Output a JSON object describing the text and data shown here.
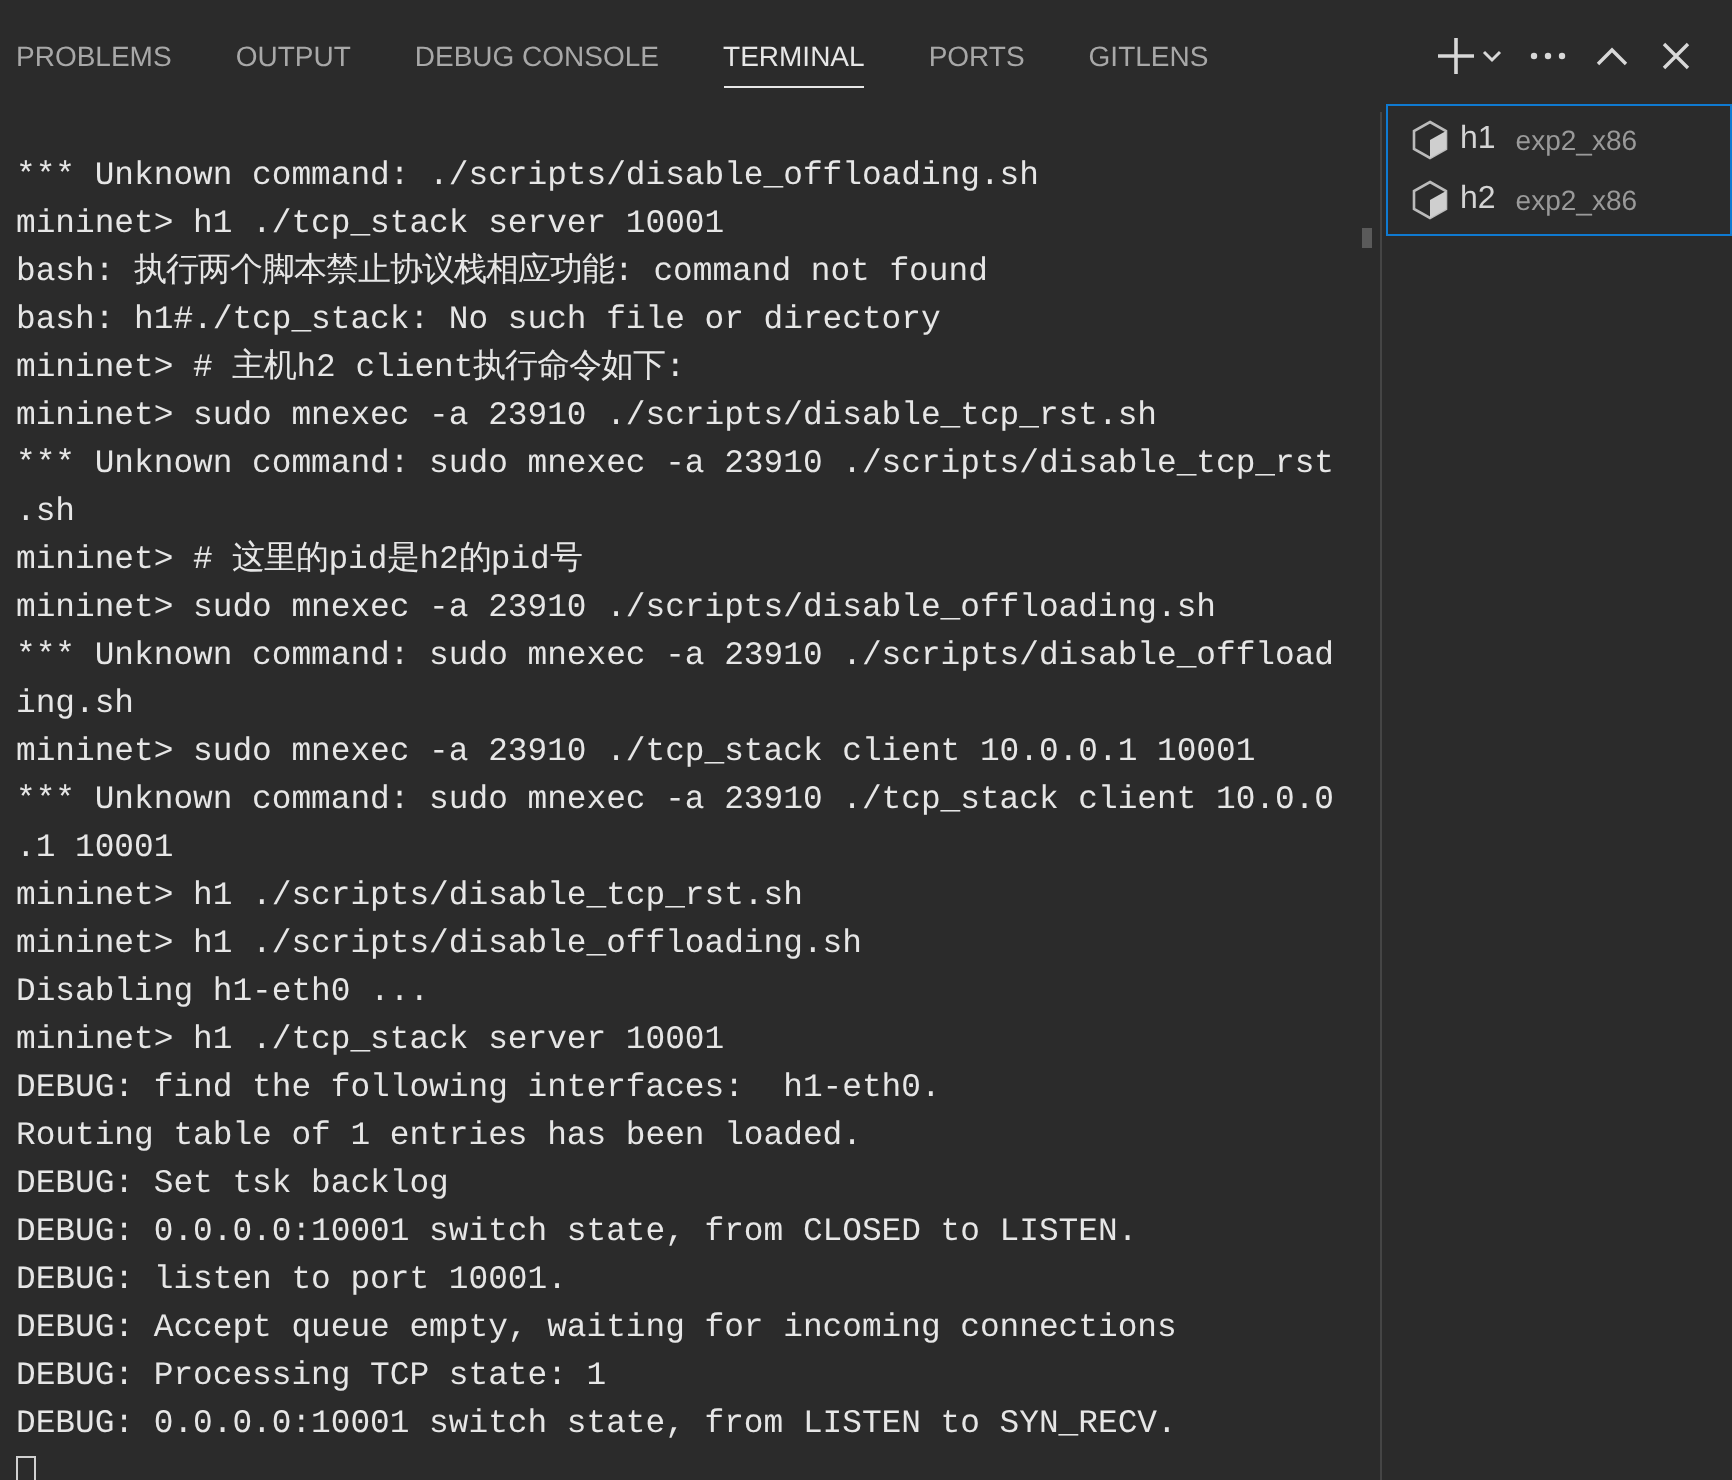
{
  "tabs": [
    {
      "label": "PROBLEMS",
      "selected": false
    },
    {
      "label": "OUTPUT",
      "selected": false
    },
    {
      "label": "DEBUG CONSOLE",
      "selected": false
    },
    {
      "label": "TERMINAL",
      "selected": true
    },
    {
      "label": "PORTS",
      "selected": false
    },
    {
      "label": "GITLENS",
      "selected": false
    }
  ],
  "terminal_lines": [
    "*** Unknown command: ./scripts/disable_offloading.sh",
    "mininet> h1 ./tcp_stack server 10001",
    "bash: 执行两个脚本禁止协议栈相应功能: command not found",
    "bash: h1#./tcp_stack: No such file or directory",
    "mininet> # 主机h2 client执行命令如下:",
    "mininet> sudo mnexec -a 23910 ./scripts/disable_tcp_rst.sh",
    "*** Unknown command: sudo mnexec -a 23910 ./scripts/disable_tcp_rst",
    ".sh",
    "mininet> # 这里的pid是h2的pid号",
    "mininet> sudo mnexec -a 23910 ./scripts/disable_offloading.sh",
    "*** Unknown command: sudo mnexec -a 23910 ./scripts/disable_offload",
    "ing.sh",
    "mininet> sudo mnexec -a 23910 ./tcp_stack client 10.0.0.1 10001",
    "*** Unknown command: sudo mnexec -a 23910 ./tcp_stack client 10.0.0",
    ".1 10001",
    "mininet> h1 ./scripts/disable_tcp_rst.sh",
    "mininet> h1 ./scripts/disable_offloading.sh",
    "Disabling h1-eth0 ...",
    "mininet> h1 ./tcp_stack server 10001",
    "DEBUG: find the following interfaces:  h1-eth0.",
    "Routing table of 1 entries has been loaded.",
    "DEBUG: Set tsk backlog",
    "DEBUG: 0.0.0.0:10001 switch state, from CLOSED to LISTEN.",
    "DEBUG: listen to port 10001.",
    "DEBUG: Accept queue empty, waiting for incoming connections",
    "DEBUG: Processing TCP state: 1",
    "DEBUG: 0.0.0.0:10001 switch state, from LISTEN to SYN_RECV."
  ],
  "terminals": [
    {
      "name": "h1",
      "detail": "exp2_x86"
    },
    {
      "name": "h2",
      "detail": "exp2_x86"
    }
  ]
}
